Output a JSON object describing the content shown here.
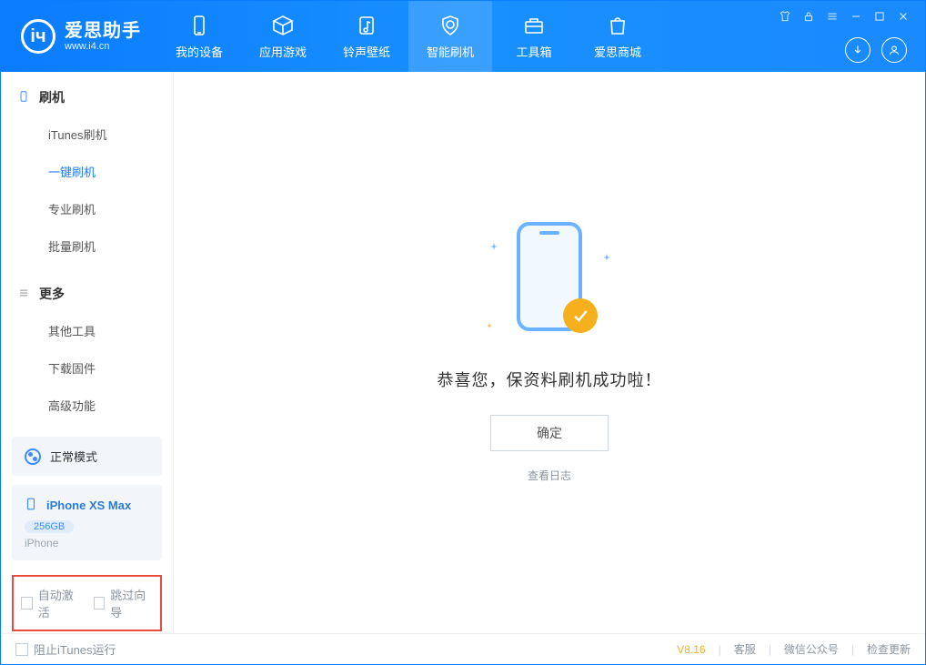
{
  "app": {
    "title": "爱思助手",
    "url": "www.i4.cn"
  },
  "nav": {
    "items": [
      {
        "label": "我的设备"
      },
      {
        "label": "应用游戏"
      },
      {
        "label": "铃声壁纸"
      },
      {
        "label": "智能刷机"
      },
      {
        "label": "工具箱"
      },
      {
        "label": "爱思商城"
      }
    ]
  },
  "sidebar": {
    "section1": {
      "title": "刷机",
      "items": [
        "iTunes刷机",
        "一键刷机",
        "专业刷机",
        "批量刷机"
      ]
    },
    "section2": {
      "title": "更多",
      "items": [
        "其他工具",
        "下载固件",
        "高级功能"
      ]
    }
  },
  "mode_card": {
    "label": "正常模式"
  },
  "device_card": {
    "name": "iPhone XS Max",
    "storage": "256GB",
    "type": "iPhone"
  },
  "options": {
    "auto_activate": "自动激活",
    "skip_guide": "跳过向导"
  },
  "main": {
    "success_text": "恭喜您，保资料刷机成功啦！",
    "ok_button": "确定",
    "view_log": "查看日志"
  },
  "footer": {
    "block_itunes": "阻止iTunes运行",
    "version": "V8.16",
    "links": [
      "客服",
      "微信公众号",
      "检查更新"
    ]
  }
}
